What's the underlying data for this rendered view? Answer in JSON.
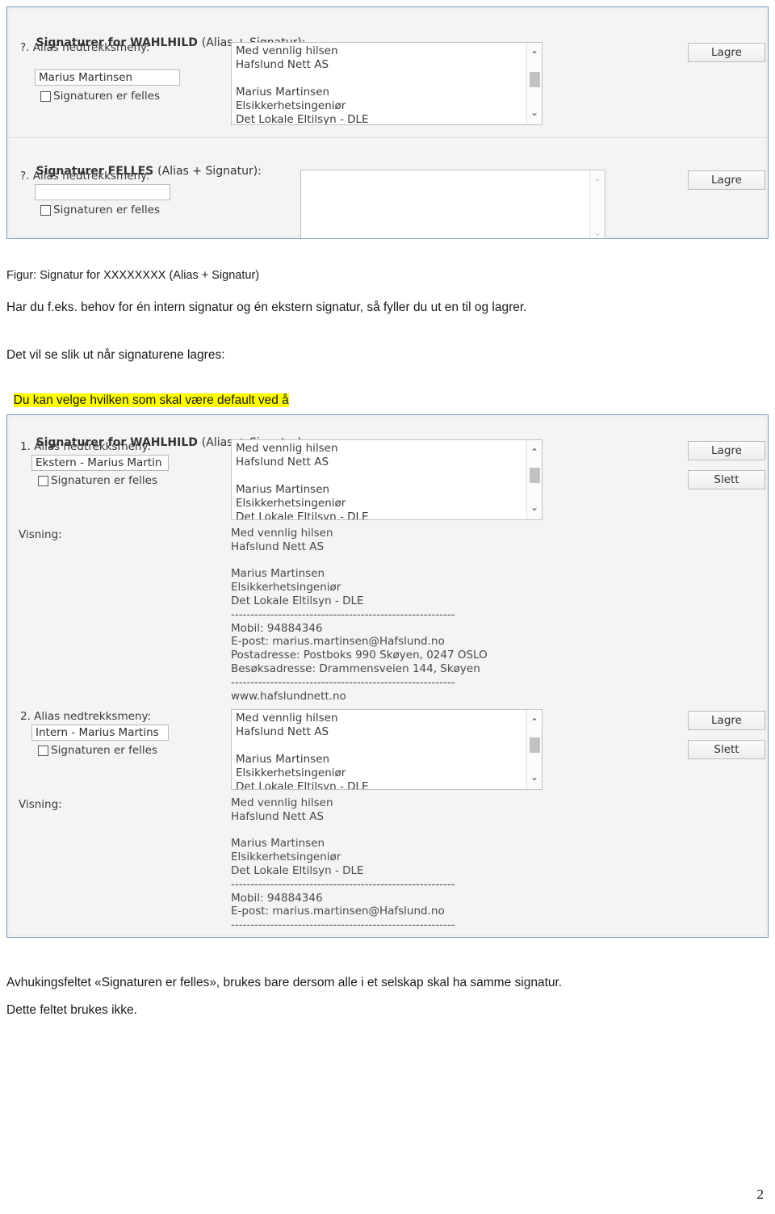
{
  "page": {
    "number": "2"
  },
  "figure_top": {
    "section1": {
      "heading_bold": "Signaturer for WAHLHILD ",
      "heading_rest": "(Alias + Signatur):",
      "dropdown_label": "?. Alias nedtrekksmeny:",
      "alias_value": "Marius Martinsen",
      "checkbox_label": "Signaturen er felles",
      "checkbox_checked": false,
      "textarea_value": "Med vennlig hilsen\nHafslund Nett AS\n\nMarius Martinsen\nElsikkerhetsingeniør\nDet Lokale Eltilsyn - DLE",
      "save_button": "Lagre",
      "scroll_up": "⌃",
      "scroll_down": "⌄"
    },
    "section2": {
      "heading_bold": "Signaturer FELLES ",
      "heading_rest": "(Alias + Signatur):",
      "dropdown_label": "?. Alias nedtrekksmeny:",
      "alias_value": "",
      "checkbox_label": "Signaturen er felles",
      "checkbox_checked": false,
      "textarea_value": "",
      "save_button": "Lagre",
      "scroll_up": "⌃",
      "scroll_down": "⌄"
    }
  },
  "body": {
    "figure_caption": "Figur: Signatur for XXXXXXXX (Alias + Signatur)",
    "paragraph1": "Har du f.eks. behov for én intern signatur og én ekstern signatur, så fyller du ut en til og lagrer.",
    "paragraph2": "Det vil se slik ut når signaturene lagres:",
    "paragraph2_highlight": "Du kan velge hvilken som skal være default ved å",
    "paragraph3_line1": "Avhukingsfeltet «Signaturen er felles», brukes bare dersom alle i et selskap skal ha samme signatur.",
    "paragraph3_line2": "Dette feltet brukes ikke."
  },
  "figure_bottom": {
    "heading_bold": "Signaturer for WAHLHILD ",
    "heading_rest": "(Alias + Signatur):",
    "entry1": {
      "dropdown_label": "1. Alias nedtrekksmeny:",
      "alias_value": "Ekstern - Marius Martin",
      "checkbox_label": "Signaturen er felles",
      "checkbox_checked": false,
      "textarea_value": "Med vennlig hilsen\nHafslund Nett AS\n\nMarius Martinsen\nElsikkerhetsingeniør\nDet Lokale Eltilsyn - DLE",
      "visning_label": "Visning:",
      "preview_text": "Med vennlig hilsen\nHafslund Nett AS\n\nMarius Martinsen\nElsikkerhetsingeniør\nDet Lokale Eltilsyn - DLE\n---------------------------------------------------------\nMobil: 94884346\nE-post: marius.martinsen@Hafslund.no\nPostadresse: Postboks 990 Skøyen, 0247 OSLO\nBesøksadresse: Drammensveien 144, Skøyen\n---------------------------------------------------------\nwww.hafslundnett.no",
      "save_button": "Lagre",
      "delete_button": "Slett"
    },
    "entry2": {
      "dropdown_label": "2. Alias nedtrekksmeny:",
      "alias_value": "Intern - Marius Martins",
      "checkbox_label": "Signaturen er felles",
      "checkbox_checked": false,
      "textarea_value": "Med vennlig hilsen\nHafslund Nett AS\n\nMarius Martinsen\nElsikkerhetsingeniør\nDet Lokale Eltilsyn - DLE",
      "visning_label": "Visning:",
      "preview_text": "Med vennlig hilsen\nHafslund Nett AS\n\nMarius Martinsen\nElsikkerhetsingeniør\nDet Lokale Eltilsyn - DLE\n---------------------------------------------------------\nMobil: 94884346\nE-post: marius.martinsen@Hafslund.no\n---------------------------------------------------------",
      "save_button": "Lagre",
      "delete_button": "Slett"
    },
    "scroll_up": "⌃",
    "scroll_down": "⌄"
  }
}
